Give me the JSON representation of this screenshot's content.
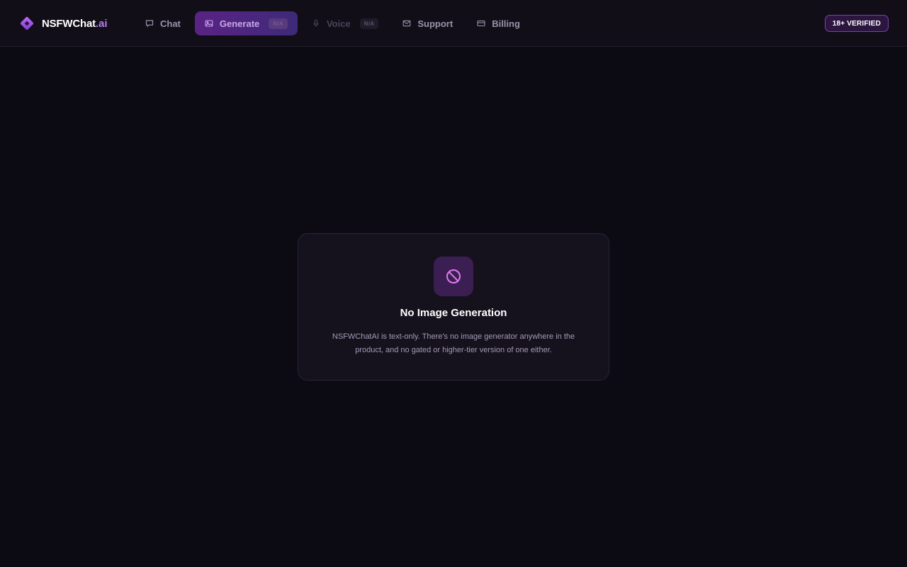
{
  "brand": {
    "name": "NSFWChat",
    "tld": ".ai"
  },
  "nav": {
    "chat": {
      "label": "Chat",
      "icon": "chat-bubble-icon"
    },
    "generate": {
      "label": "Generate",
      "badge": "N/A",
      "icon": "image-icon"
    },
    "voice": {
      "label": "Voice",
      "badge": "N/A",
      "icon": "microphone-icon"
    },
    "support": {
      "label": "Support",
      "icon": "mail-icon"
    },
    "billing": {
      "label": "Billing",
      "icon": "credit-card-icon"
    }
  },
  "verified_badge": "18+ VERIFIED",
  "notice": {
    "icon": "prohibited-icon",
    "title": "No Image Generation",
    "body": "NSFWChatAI is text-only. There's no image generator anywhere in the product, and no gated or higher-tier version of one either."
  },
  "colors": {
    "background": "#0c0a12",
    "topbar": "#110e18",
    "accent": "#b57ef0",
    "active_tab_start": "#5a2385",
    "active_tab_end": "#3d2a78",
    "icon_tint": "#e27bf0"
  }
}
